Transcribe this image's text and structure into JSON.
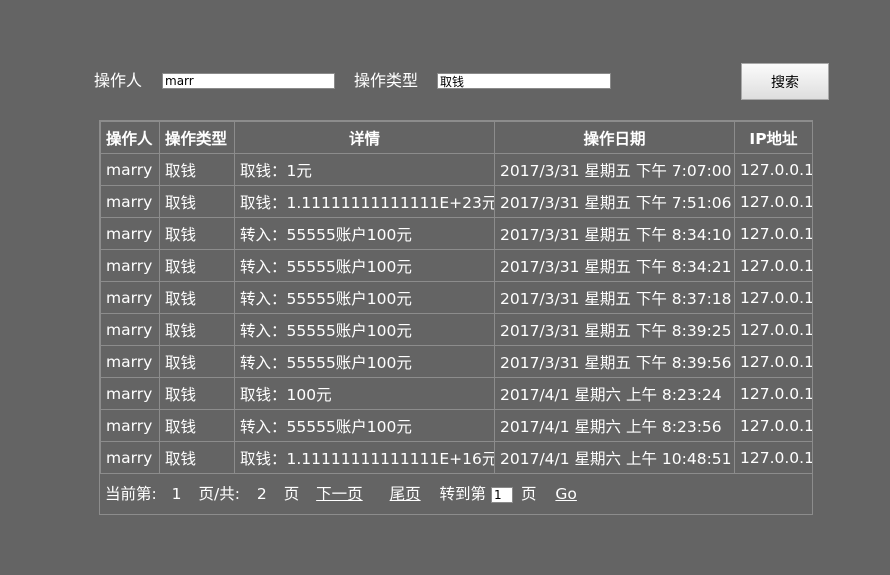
{
  "search": {
    "operator_label": "操作人",
    "operator_value": "marr",
    "optype_label": "操作类型",
    "optype_value": "取钱",
    "search_button": "搜索"
  },
  "table": {
    "headers": [
      "操作人",
      "操作类型",
      "详情",
      "操作日期",
      "IP地址"
    ],
    "rows": [
      [
        "marry",
        "取钱",
        "取钱：1元",
        "2017/3/31 星期五 下午 7:07:00",
        "127.0.0.1"
      ],
      [
        "marry",
        "取钱",
        "取钱：1.11111111111111E+23元",
        "2017/3/31 星期五 下午 7:51:06",
        "127.0.0.1"
      ],
      [
        "marry",
        "取钱",
        "转入：55555账户100元",
        "2017/3/31 星期五 下午 8:34:10",
        "127.0.0.1"
      ],
      [
        "marry",
        "取钱",
        "转入：55555账户100元",
        "2017/3/31 星期五 下午 8:34:21",
        "127.0.0.1"
      ],
      [
        "marry",
        "取钱",
        "转入：55555账户100元",
        "2017/3/31 星期五 下午 8:37:18",
        "127.0.0.1"
      ],
      [
        "marry",
        "取钱",
        "转入：55555账户100元",
        "2017/3/31 星期五 下午 8:39:25",
        "127.0.0.1"
      ],
      [
        "marry",
        "取钱",
        "转入：55555账户100元",
        "2017/3/31 星期五 下午 8:39:56",
        "127.0.0.1"
      ],
      [
        "marry",
        "取钱",
        "取钱：100元",
        "2017/4/1 星期六 上午 8:23:24",
        "127.0.0.1"
      ],
      [
        "marry",
        "取钱",
        "转入：55555账户100元",
        "2017/4/1 星期六 上午 8:23:56",
        "127.0.0.1"
      ],
      [
        "marry",
        "取钱",
        "取钱：1.11111111111111E+16元",
        "2017/4/1 星期六 上午 10:48:51",
        "127.0.0.1"
      ]
    ]
  },
  "pager": {
    "current_label": "当前第:",
    "current_page": "1",
    "total_label": "页/共:",
    "total_pages": "2",
    "page_unit": "页",
    "next_link": "下一页",
    "last_link": "尾页",
    "goto_label": "转到第",
    "goto_value": "1",
    "goto_unit": "页",
    "go_link": "Go"
  }
}
